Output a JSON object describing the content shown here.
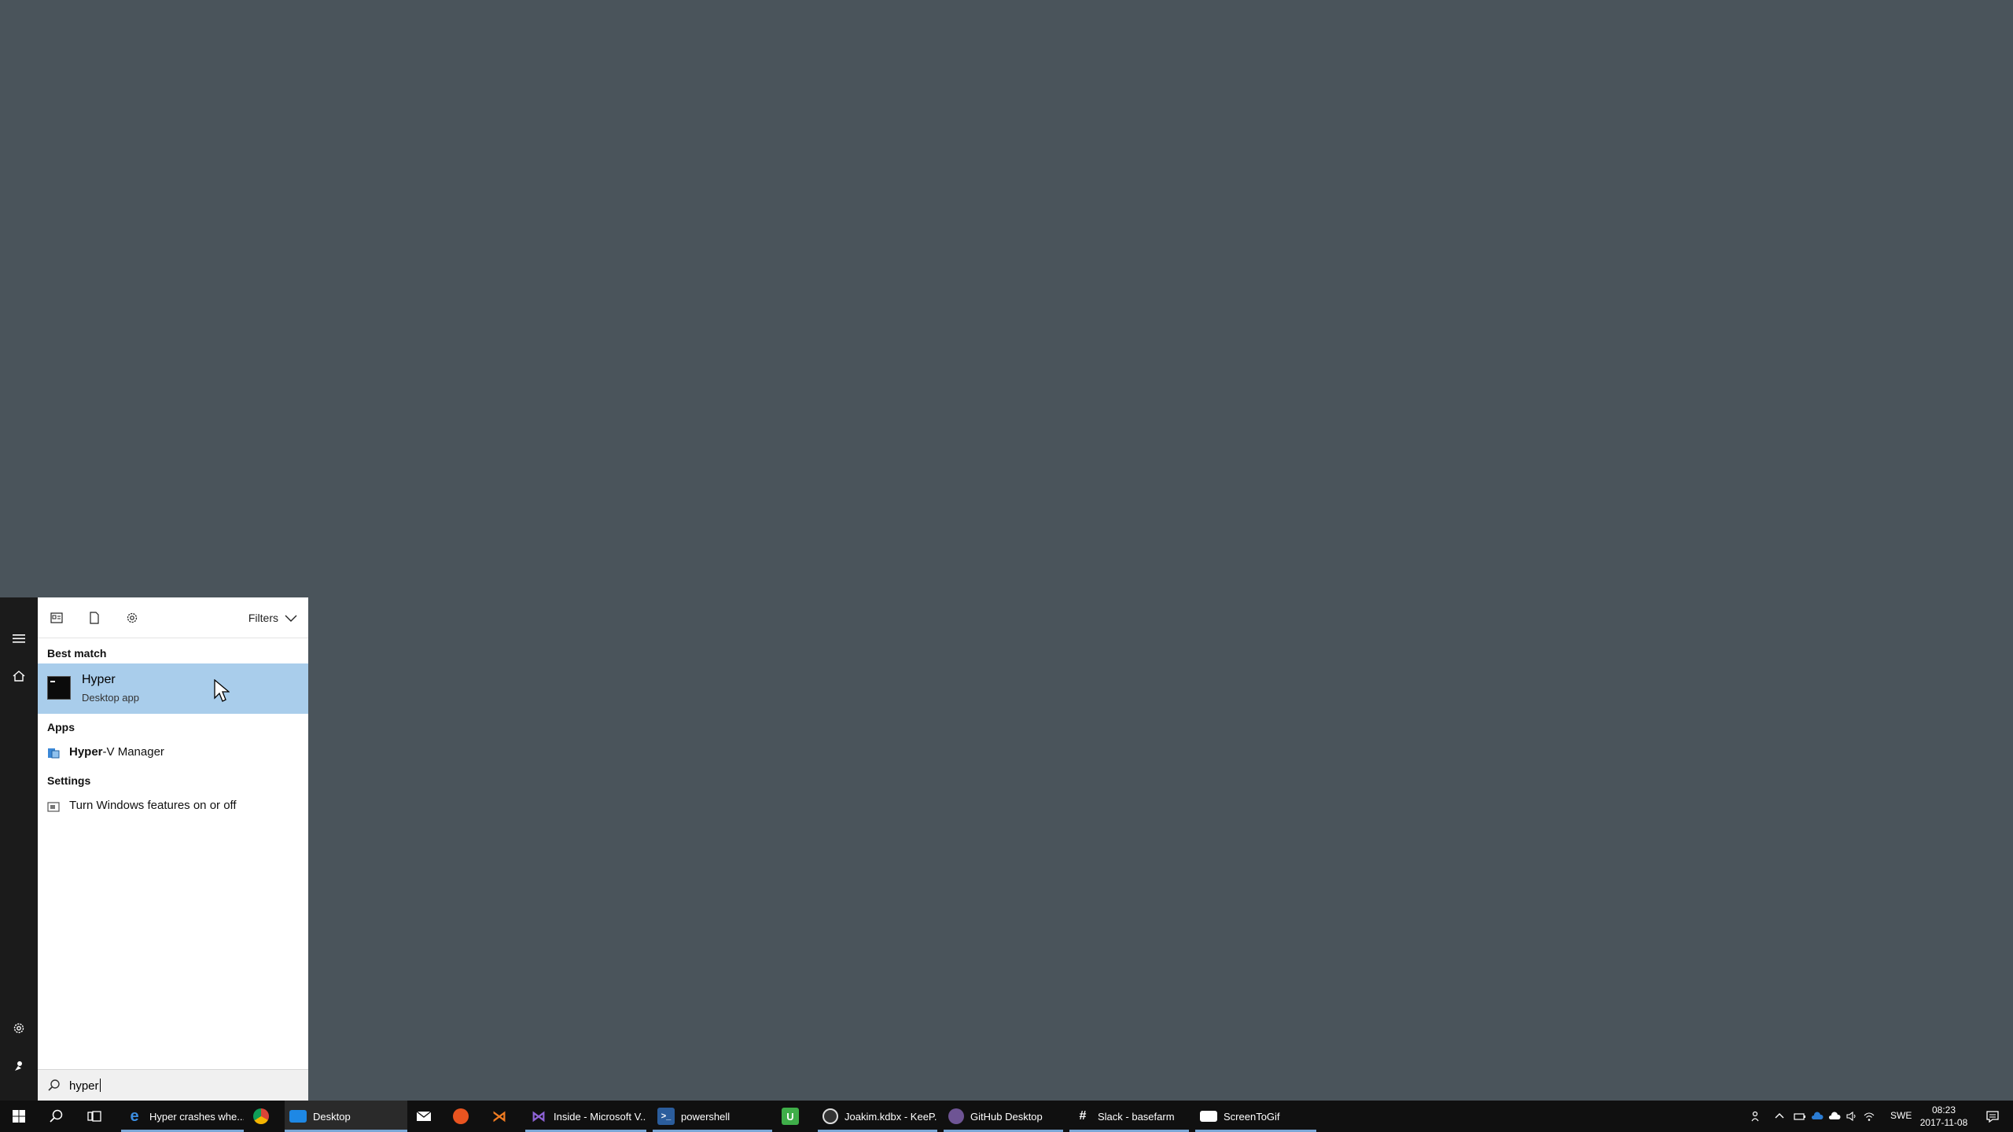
{
  "colors": {
    "desktop": "#4a545b",
    "panel": "#ffffff",
    "rail": "#1b1b1b",
    "selected": "#a9cdeb",
    "taskbar": "#101010",
    "accent": "#7aa7d6"
  },
  "filterbar": {
    "icons": [
      "apps-filter-icon",
      "documents-filter-icon",
      "settings-filter-icon"
    ],
    "filters_label": "Filters"
  },
  "results": {
    "best_match_header": "Best match",
    "best_match": {
      "title": "Hyper",
      "subtitle": "Desktop app",
      "icon": "terminal-icon"
    },
    "apps_header": "Apps",
    "apps": [
      {
        "bold": "Hyper",
        "rest": "-V Manager",
        "icon": "hyperv-icon"
      }
    ],
    "settings_header": "Settings",
    "settings": [
      {
        "label": "Turn Windows features on or off",
        "icon": "windows-features-icon"
      }
    ]
  },
  "search": {
    "value": "hyper"
  },
  "taskbar": {
    "apps": [
      {
        "label": "Hyper crashes whe...",
        "icon": "edge-icon"
      },
      {
        "label": "",
        "icon": "chrome-icon"
      },
      {
        "label": "Desktop",
        "icon": "desktop-icon"
      },
      {
        "label": "",
        "icon": "mail-icon"
      },
      {
        "label": "",
        "icon": "ubuntu-icon"
      },
      {
        "label": "",
        "icon": "vscode-icon"
      },
      {
        "label": "Inside - Microsoft V...",
        "icon": "visual-studio-icon"
      },
      {
        "label": "powershell",
        "icon": "powershell-icon"
      },
      {
        "label": "",
        "icon": "upwork-icon"
      },
      {
        "label": "Joakim.kdbx - KeeP...",
        "icon": "keepass-icon"
      },
      {
        "label": "GitHub Desktop",
        "icon": "github-icon"
      },
      {
        "label": "Slack - basefarm",
        "icon": "slack-icon"
      },
      {
        "label": "ScreenToGif",
        "icon": "screentogif-icon"
      }
    ],
    "language": "SWE",
    "time": "08:23",
    "date": "2017-11-08"
  }
}
